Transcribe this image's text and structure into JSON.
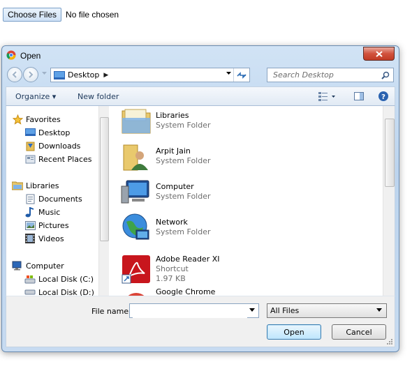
{
  "page": {
    "choose_files_label": "Choose Files",
    "no_file_text": "No file chosen"
  },
  "dialog": {
    "title": "Open",
    "address": {
      "location": "Desktop"
    },
    "search": {
      "placeholder": "Search Desktop"
    },
    "toolbar": {
      "organize_label": "Organize ▾",
      "new_folder_label": "New folder"
    },
    "nav": {
      "favorites": [
        "Favorites",
        "Desktop",
        "Downloads",
        "Recent Places"
      ],
      "libraries": [
        "Libraries",
        "Documents",
        "Music",
        "Pictures",
        "Videos"
      ],
      "computer": [
        "Computer",
        "Local Disk (C:)",
        "Local Disk (D:)"
      ]
    },
    "files": [
      {
        "name": "Libraries",
        "sub": "System Folder"
      },
      {
        "name": "Arpit Jain",
        "sub": "System Folder"
      },
      {
        "name": "Computer",
        "sub": "System Folder"
      },
      {
        "name": "Network",
        "sub": "System Folder"
      },
      {
        "name": "Adobe Reader XI",
        "sub": "Shortcut",
        "size": "1.97 KB"
      },
      {
        "name": "Google Chrome",
        "sub": ""
      }
    ],
    "footer": {
      "file_name_label": "File name:",
      "file_name_value": "",
      "filter_value": "All Files",
      "open_label": "Open",
      "cancel_label": "Cancel"
    }
  },
  "colors": {
    "accent": "#3c7fb1",
    "title_bg": "#c7dbf1",
    "close": "#c13b25"
  }
}
